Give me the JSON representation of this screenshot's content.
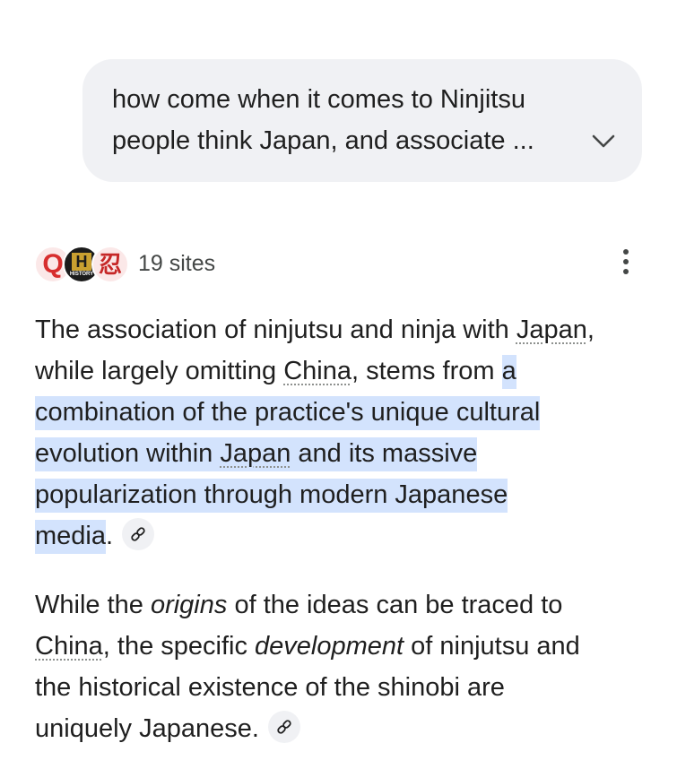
{
  "query": {
    "line1": "how come when it comes to Ninjitsu",
    "line2": "people think Japan, and associate ..."
  },
  "sources": {
    "favicons": [
      "quora-icon",
      "history-channel-icon",
      "ninja-site-icon"
    ],
    "favicon_q": "Q",
    "favicon_h": "H",
    "favicon_h_caption": "HISTORY",
    "favicon_n": "忍",
    "count_label": "19 sites"
  },
  "answer": {
    "p1": {
      "l1a": "The association of ninjutsu and ninja with ",
      "l1_entity": "Japan",
      "l1b": ",",
      "l2a": "while largely omitting ",
      "l2_entity": "China",
      "l2b": ", stems from ",
      "l2_hl": "a",
      "l3_hl": "combination of the practice's unique cultural",
      "l4_hl_a": "evolution within ",
      "l4_hl_entity": "Japan",
      "l4_hl_b": " and its massive",
      "l5_hl": "popularization through modern Japanese",
      "l6_hl": "media",
      "l6_end": "."
    },
    "p2": {
      "l1a": "While the ",
      "l1_em": "origins",
      "l1b": " of the ideas can be traced to",
      "l2_entity": "China",
      "l2a": ", the specific ",
      "l2_em": "development",
      "l2b": " of ninjutsu and",
      "l3": "the historical existence of the shinobi are",
      "l4": "uniquely Japanese."
    }
  }
}
